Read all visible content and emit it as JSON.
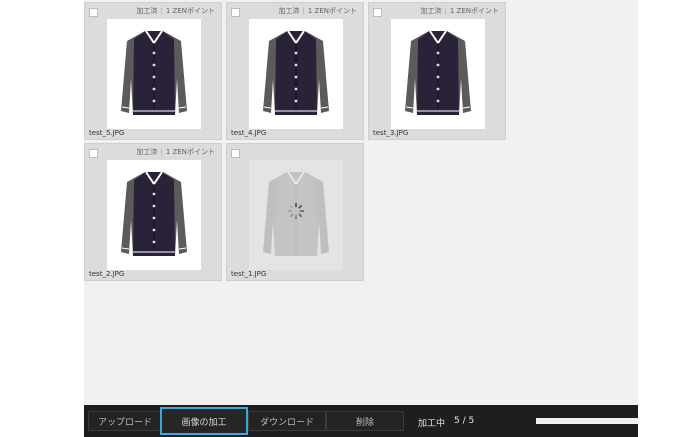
{
  "cards": [
    {
      "filename": "test_5.JPG",
      "status": "加工済",
      "points": "1 ZENポイント",
      "processing": false
    },
    {
      "filename": "test_4.JPG",
      "status": "加工済",
      "points": "1 ZENポイント",
      "processing": false
    },
    {
      "filename": "test_3.JPG",
      "status": "加工済",
      "points": "1 ZENポイント",
      "processing": false
    },
    {
      "filename": "test_2.JPG",
      "status": "加工済",
      "points": "1 ZENポイント",
      "processing": false
    },
    {
      "filename": "test_1.JPG",
      "status": "",
      "points": "",
      "processing": true
    }
  ],
  "toolbar": {
    "upload_label": "アップロード",
    "process_label": "画像の加工",
    "download_label": "ダウンロード",
    "delete_label": "削除",
    "status_label": "加工中",
    "count_label": "5 / 5",
    "progress_fraction": 1.0
  },
  "colors": {
    "accent": "#3da7e0",
    "toolbar_bg": "#1e1e1e",
    "jacket_body": "#2a2238",
    "jacket_sleeve": "#5b5b5b"
  }
}
